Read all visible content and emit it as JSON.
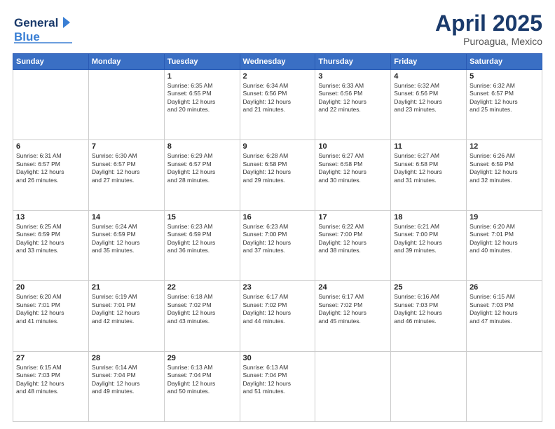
{
  "header": {
    "logo_line1": "General",
    "logo_line2": "Blue",
    "title": "April 2025",
    "subtitle": "Puroagua, Mexico"
  },
  "calendar": {
    "days_of_week": [
      "Sunday",
      "Monday",
      "Tuesday",
      "Wednesday",
      "Thursday",
      "Friday",
      "Saturday"
    ],
    "weeks": [
      [
        {
          "day": "",
          "detail": ""
        },
        {
          "day": "",
          "detail": ""
        },
        {
          "day": "1",
          "detail": "Sunrise: 6:35 AM\nSunset: 6:55 PM\nDaylight: 12 hours\nand 20 minutes."
        },
        {
          "day": "2",
          "detail": "Sunrise: 6:34 AM\nSunset: 6:56 PM\nDaylight: 12 hours\nand 21 minutes."
        },
        {
          "day": "3",
          "detail": "Sunrise: 6:33 AM\nSunset: 6:56 PM\nDaylight: 12 hours\nand 22 minutes."
        },
        {
          "day": "4",
          "detail": "Sunrise: 6:32 AM\nSunset: 6:56 PM\nDaylight: 12 hours\nand 23 minutes."
        },
        {
          "day": "5",
          "detail": "Sunrise: 6:32 AM\nSunset: 6:57 PM\nDaylight: 12 hours\nand 25 minutes."
        }
      ],
      [
        {
          "day": "6",
          "detail": "Sunrise: 6:31 AM\nSunset: 6:57 PM\nDaylight: 12 hours\nand 26 minutes."
        },
        {
          "day": "7",
          "detail": "Sunrise: 6:30 AM\nSunset: 6:57 PM\nDaylight: 12 hours\nand 27 minutes."
        },
        {
          "day": "8",
          "detail": "Sunrise: 6:29 AM\nSunset: 6:57 PM\nDaylight: 12 hours\nand 28 minutes."
        },
        {
          "day": "9",
          "detail": "Sunrise: 6:28 AM\nSunset: 6:58 PM\nDaylight: 12 hours\nand 29 minutes."
        },
        {
          "day": "10",
          "detail": "Sunrise: 6:27 AM\nSunset: 6:58 PM\nDaylight: 12 hours\nand 30 minutes."
        },
        {
          "day": "11",
          "detail": "Sunrise: 6:27 AM\nSunset: 6:58 PM\nDaylight: 12 hours\nand 31 minutes."
        },
        {
          "day": "12",
          "detail": "Sunrise: 6:26 AM\nSunset: 6:59 PM\nDaylight: 12 hours\nand 32 minutes."
        }
      ],
      [
        {
          "day": "13",
          "detail": "Sunrise: 6:25 AM\nSunset: 6:59 PM\nDaylight: 12 hours\nand 33 minutes."
        },
        {
          "day": "14",
          "detail": "Sunrise: 6:24 AM\nSunset: 6:59 PM\nDaylight: 12 hours\nand 35 minutes."
        },
        {
          "day": "15",
          "detail": "Sunrise: 6:23 AM\nSunset: 6:59 PM\nDaylight: 12 hours\nand 36 minutes."
        },
        {
          "day": "16",
          "detail": "Sunrise: 6:23 AM\nSunset: 7:00 PM\nDaylight: 12 hours\nand 37 minutes."
        },
        {
          "day": "17",
          "detail": "Sunrise: 6:22 AM\nSunset: 7:00 PM\nDaylight: 12 hours\nand 38 minutes."
        },
        {
          "day": "18",
          "detail": "Sunrise: 6:21 AM\nSunset: 7:00 PM\nDaylight: 12 hours\nand 39 minutes."
        },
        {
          "day": "19",
          "detail": "Sunrise: 6:20 AM\nSunset: 7:01 PM\nDaylight: 12 hours\nand 40 minutes."
        }
      ],
      [
        {
          "day": "20",
          "detail": "Sunrise: 6:20 AM\nSunset: 7:01 PM\nDaylight: 12 hours\nand 41 minutes."
        },
        {
          "day": "21",
          "detail": "Sunrise: 6:19 AM\nSunset: 7:01 PM\nDaylight: 12 hours\nand 42 minutes."
        },
        {
          "day": "22",
          "detail": "Sunrise: 6:18 AM\nSunset: 7:02 PM\nDaylight: 12 hours\nand 43 minutes."
        },
        {
          "day": "23",
          "detail": "Sunrise: 6:17 AM\nSunset: 7:02 PM\nDaylight: 12 hours\nand 44 minutes."
        },
        {
          "day": "24",
          "detail": "Sunrise: 6:17 AM\nSunset: 7:02 PM\nDaylight: 12 hours\nand 45 minutes."
        },
        {
          "day": "25",
          "detail": "Sunrise: 6:16 AM\nSunset: 7:03 PM\nDaylight: 12 hours\nand 46 minutes."
        },
        {
          "day": "26",
          "detail": "Sunrise: 6:15 AM\nSunset: 7:03 PM\nDaylight: 12 hours\nand 47 minutes."
        }
      ],
      [
        {
          "day": "27",
          "detail": "Sunrise: 6:15 AM\nSunset: 7:03 PM\nDaylight: 12 hours\nand 48 minutes."
        },
        {
          "day": "28",
          "detail": "Sunrise: 6:14 AM\nSunset: 7:04 PM\nDaylight: 12 hours\nand 49 minutes."
        },
        {
          "day": "29",
          "detail": "Sunrise: 6:13 AM\nSunset: 7:04 PM\nDaylight: 12 hours\nand 50 minutes."
        },
        {
          "day": "30",
          "detail": "Sunrise: 6:13 AM\nSunset: 7:04 PM\nDaylight: 12 hours\nand 51 minutes."
        },
        {
          "day": "",
          "detail": ""
        },
        {
          "day": "",
          "detail": ""
        },
        {
          "day": "",
          "detail": ""
        }
      ]
    ]
  }
}
